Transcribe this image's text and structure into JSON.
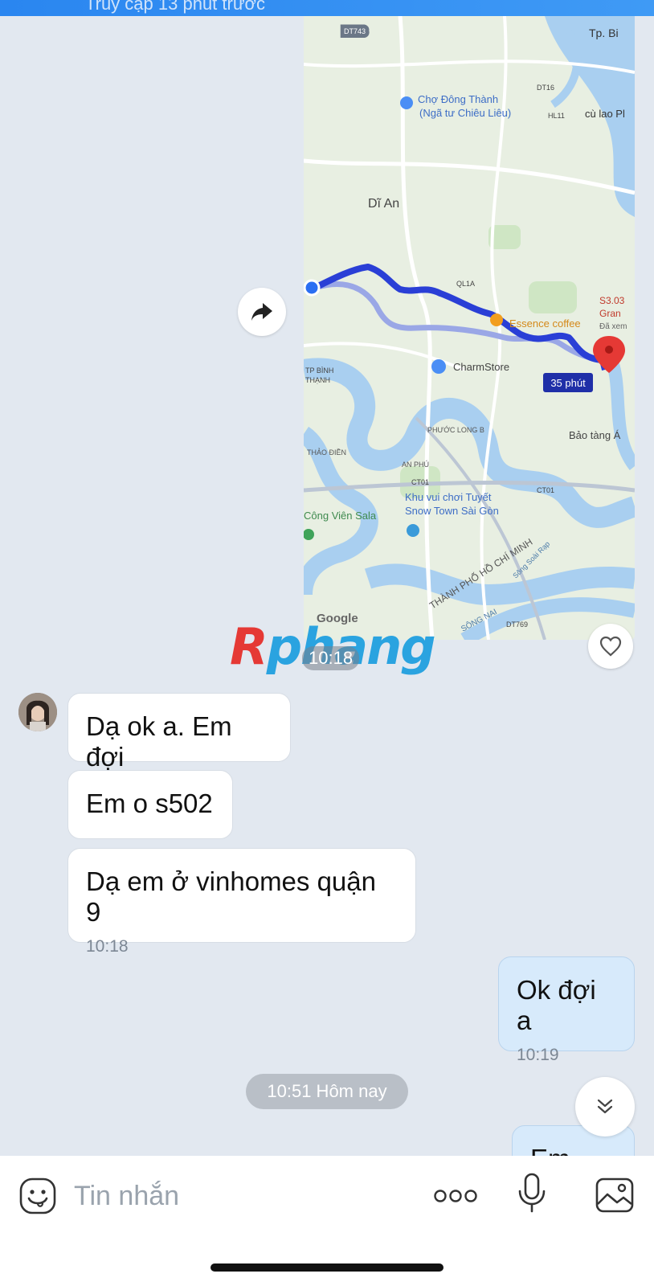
{
  "header": {
    "status_text": "Truy cập 13 phút trước"
  },
  "map": {
    "labels": {
      "dt743": "DT743",
      "tp": "Tp. Bi",
      "dt16": "DT16",
      "cho_dong_thanh": "Chợ Đông Thành",
      "nga_tu": "(Ngã tư Chiêu Liêu)",
      "hl11": "HL11",
      "cu_lao": "cù lao Pl",
      "di_an": "Dĩ An",
      "ql1a": "QL1A",
      "s303": "S3.03",
      "gran": "Gran",
      "da_xem": "Đã xem",
      "essence": "Essence coffee",
      "charmstore": "CharmStore",
      "eta": "35 phút",
      "tp_binh": "TP BÌNH",
      "thanh": "THẠNH",
      "phuoc_long": "PHƯỚC LONG B",
      "bao_tang": "Bảo tàng Á",
      "thao_dien": "THẢO ĐIỀN",
      "an_phu": "AN PHÚ",
      "ct01": "CT01",
      "ct01b": "CT01",
      "khu_vui_choi": "Khu vui chơi Tuyết",
      "snow_town": "Snow Town Sài Gòn",
      "cong_vien": "Công Viên Sala",
      "tphcm": "THÀNH PHỐ HỒ CHÍ MINH",
      "song_soai_rap": "Sông Soài Rạp",
      "song_nai": "SÔNG NAI",
      "dt769": "DT769",
      "google": "Google"
    },
    "route_color": "#2a3fd6",
    "alt_route_color": "#9aa7e6",
    "water_color": "#a9cff0",
    "land_color": "#e8efe2"
  },
  "watermark": {
    "part1": "R",
    "part2": "phang"
  },
  "map_time": "10:18",
  "messages": [
    {
      "text": "Dạ ok a. Em đợi",
      "time": ""
    },
    {
      "text": "Em o s502",
      "time": ""
    },
    {
      "text": "Dạ em ở vinhomes quận 9",
      "time": "10:18"
    },
    {
      "text": "Ok đợi a",
      "time": "10:19"
    },
    {
      "text": "Em ...",
      "time": ""
    }
  ],
  "day_separator": "10:51 Hôm nay",
  "composer": {
    "placeholder": "Tin nhắn"
  },
  "icons": {
    "share": "forward-arrow-icon",
    "heart": "heart-icon",
    "scroll": "double-chevron-down-icon",
    "emoji": "sticker-emoji-icon",
    "more": "more-dots-icon",
    "mic": "microphone-icon",
    "image": "image-icon"
  }
}
